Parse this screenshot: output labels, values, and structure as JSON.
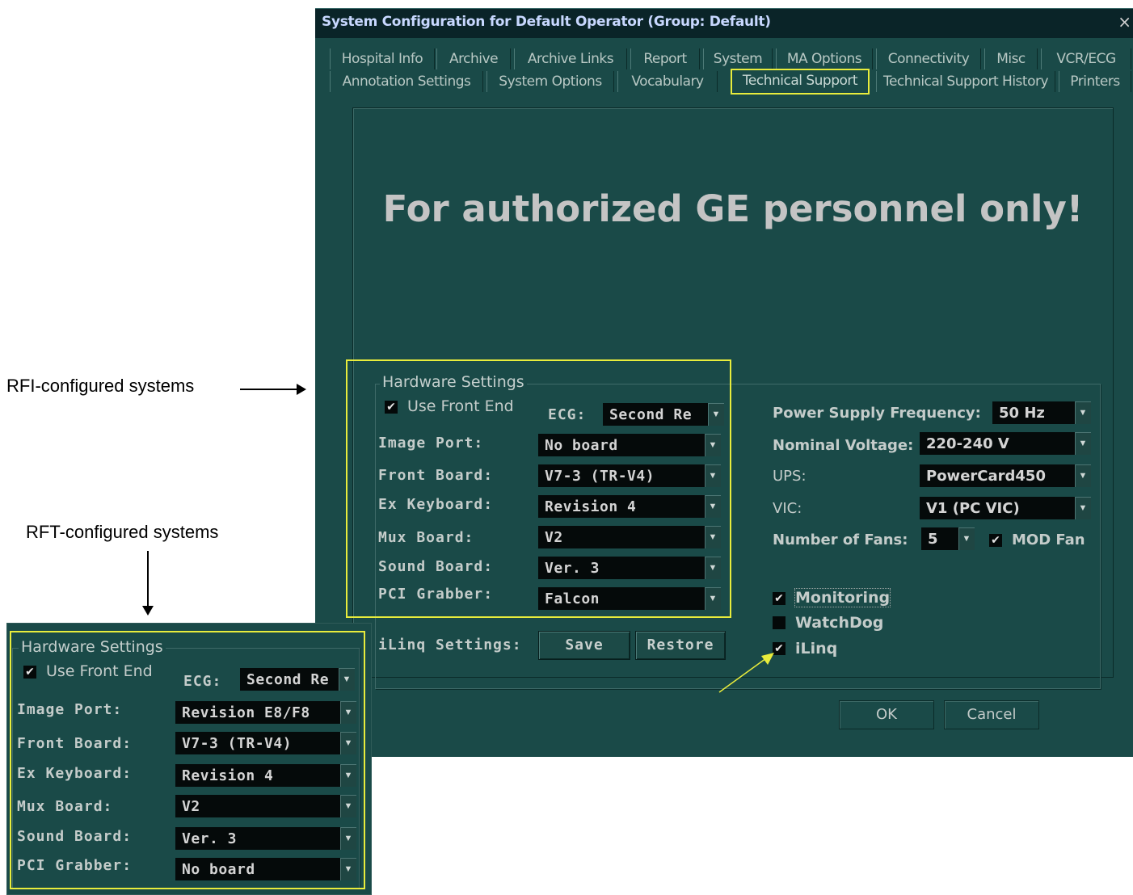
{
  "annotations": {
    "rfi": "RFI-configured systems",
    "rft": "RFT-configured systems"
  },
  "window": {
    "title": "System Configuration for Default Operator (Group: Default)",
    "close": "×"
  },
  "tabs": {
    "row1": [
      "Hospital Info",
      "Archive",
      "Archive Links",
      "Report",
      "System",
      "MA Options",
      "Connectivity",
      "Misc",
      "VCR/ECG"
    ],
    "row2": [
      "Annotation Settings",
      "System Options",
      "Vocabulary",
      "Technical Support",
      "Technical Support History",
      "Printers"
    ],
    "active": "Technical Support"
  },
  "notice": "For authorized GE personnel only!",
  "hardware": {
    "title": "Hardware Settings",
    "use_front_end": "Use Front End",
    "use_front_end_checked": true,
    "ecg_label": "ECG:",
    "ecg_value": "Second Re",
    "image_port_label": "Image Port:",
    "image_port_value": "No board",
    "front_board_label": "Front Board:",
    "front_board_value": "V7-3 (TR-V4)",
    "ex_keyboard_label": "Ex Keyboard:",
    "ex_keyboard_value": "Revision 4",
    "mux_board_label": "Mux Board:",
    "mux_board_value": "V2",
    "sound_board_label": "Sound Board:",
    "sound_board_value": "Ver. 3",
    "pci_grabber_label": "PCI Grabber:",
    "pci_grabber_value": "Falcon"
  },
  "iling": {
    "label": "iLinq Settings:",
    "save": "Save",
    "restore": "Restore"
  },
  "power": {
    "freq_label": "Power Supply Frequency:",
    "freq_value": "50 Hz",
    "voltage_label": "Nominal Voltage:",
    "voltage_value": "220-240 V",
    "ups_label": "UPS:",
    "ups_value": "PowerCard450",
    "vic_label": "VIC:",
    "vic_value": "V1 (PC VIC)",
    "fans_label": "Number of Fans:",
    "fans_value": "5",
    "mod_fan": "MOD Fan",
    "mod_fan_checked": true
  },
  "options": {
    "monitoring": "Monitoring",
    "monitoring_checked": true,
    "watchdog": "WatchDog",
    "watchdog_checked": false,
    "ilinq": "iLinq",
    "ilinq_checked": true
  },
  "footer": {
    "ok": "OK",
    "cancel": "Cancel"
  },
  "rft": {
    "title": "Hardware Settings",
    "use_front_end": "Use Front End",
    "ecg_label": "ECG:",
    "ecg_value": "Second Re",
    "image_port_label": "Image Port:",
    "image_port_value": "Revision E8/F8",
    "front_board_label": "Front Board:",
    "front_board_value": "V7-3 (TR-V4)",
    "ex_keyboard_label": "Ex Keyboard:",
    "ex_keyboard_value": "Revision 4",
    "mux_board_label": "Mux Board:",
    "mux_board_value": "V2",
    "sound_board_label": "Sound Board:",
    "sound_board_value": "Ver. 3",
    "pci_grabber_label": "PCI Grabber:",
    "pci_grabber_value": "No board"
  },
  "colors": {
    "dialog_bg": "#1a4a48",
    "highlight": "#e8ec3c",
    "titlebar": "#0a2428"
  }
}
